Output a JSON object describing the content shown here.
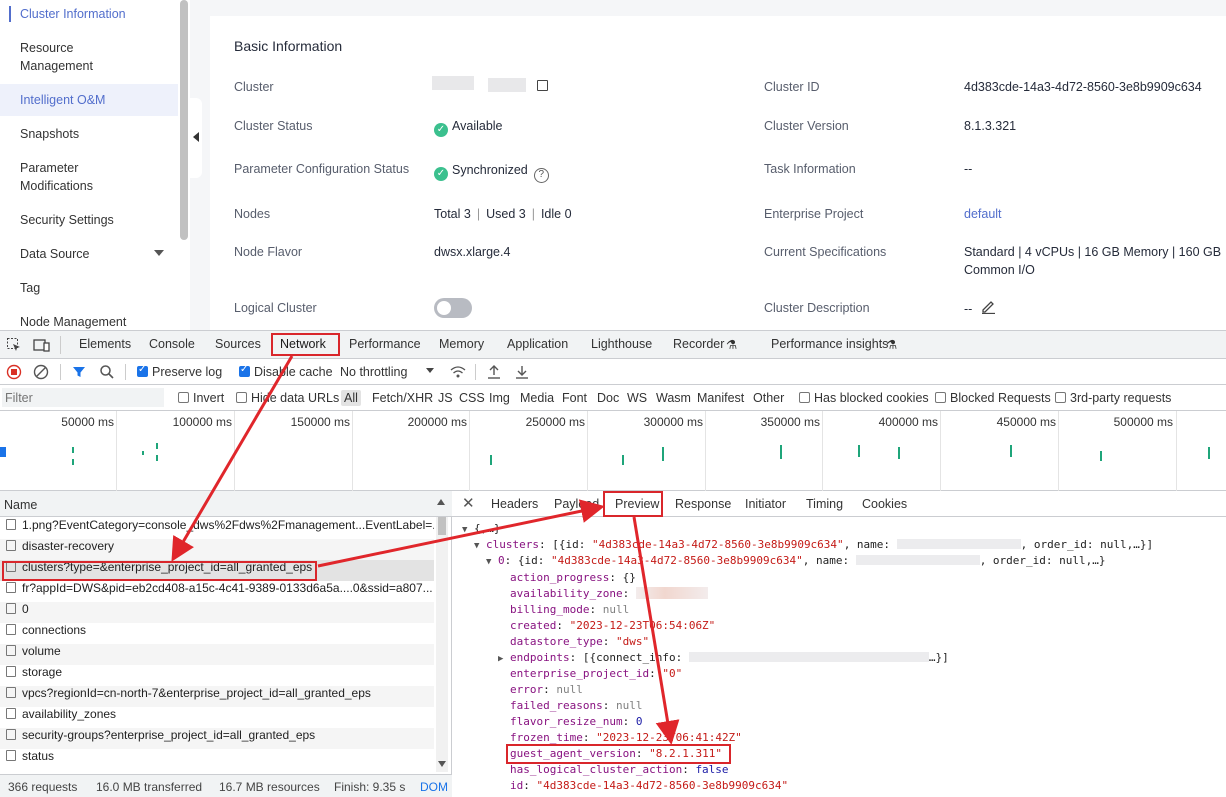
{
  "sidebar": {
    "items": [
      {
        "label": "Cluster Information"
      },
      {
        "label": "Resource Management"
      },
      {
        "label": "Intelligent O&M"
      },
      {
        "label": "Snapshots"
      },
      {
        "label": "Parameter Modifications"
      },
      {
        "label": "Security Settings"
      },
      {
        "label": "Data Source"
      },
      {
        "label": "Tag"
      },
      {
        "label": "Node Management"
      }
    ]
  },
  "basic": {
    "title": "Basic Information",
    "cluster_label": "Cluster",
    "cluster_status_label": "Cluster Status",
    "cluster_status": "Available",
    "param_status_label": "Parameter Configuration Status",
    "param_status": "Synchronized",
    "nodes_label": "Nodes",
    "nodes_total": "Total 3",
    "nodes_used": "Used 3",
    "nodes_idle": "Idle 0",
    "flavor_label": "Node Flavor",
    "flavor": "dwsx.xlarge.4",
    "logical_label": "Logical Cluster",
    "cluster_id_label": "Cluster ID",
    "cluster_id": "4d383cde-14a3-4d72-8560-3e8b9909c634",
    "version_label": "Cluster Version",
    "version": "8.1.3.321",
    "task_label": "Task Information",
    "task": "--",
    "ep_label": "Enterprise Project",
    "ep": "default",
    "spec_label": "Current Specifications",
    "spec_line1": "Standard | 4 vCPUs | 16 GB Memory | 160 GB",
    "spec_line2": "Common I/O",
    "desc_label": "Cluster Description",
    "desc": "--"
  },
  "devtools": {
    "tabs": [
      "Elements",
      "Console",
      "Sources",
      "Network",
      "Performance",
      "Memory",
      "Application",
      "Lighthouse",
      "Recorder",
      "Performance insights"
    ],
    "toolbar": {
      "preserve_log": "Preserve log",
      "disable_cache": "Disable cache",
      "throttling": "No throttling"
    },
    "filter": {
      "placeholder": "Filter",
      "invert": "Invert",
      "hide_data_urls": "Hide data URLs",
      "types": [
        "All",
        "Fetch/XHR",
        "JS",
        "CSS",
        "Img",
        "Media",
        "Font",
        "Doc",
        "WS",
        "Wasm",
        "Manifest",
        "Other"
      ],
      "has_blocked": "Has blocked cookies",
      "blocked_requests": "Blocked Requests",
      "third_party": "3rd-party requests"
    },
    "timeline_ticks": [
      "50000 ms",
      "100000 ms",
      "150000 ms",
      "200000 ms",
      "250000 ms",
      "300000 ms",
      "350000 ms",
      "400000 ms",
      "450000 ms",
      "500000 ms"
    ],
    "requests_header": "Name",
    "requests": [
      "1.png?EventCategory=console_dws%2Fdws%2Fmanagement...EventLabel=...",
      "disaster-recovery",
      "clusters?type=&enterprise_project_id=all_granted_eps",
      "fr?appId=DWS&pid=eb2cd408-a15c-4c41-9389-0133d6a5a....0&ssid=a807...",
      "0",
      "connections",
      "volume",
      "storage",
      "vpcs?regionId=cn-north-7&enterprise_project_id=all_granted_eps",
      "availability_zones",
      "security-groups?enterprise_project_id=all_granted_eps",
      "status"
    ],
    "status": {
      "requests": "366 requests",
      "transferred": "16.0 MB transferred",
      "resources": "16.7 MB resources",
      "finish": "Finish: 9.35 s",
      "dom": "DOM"
    },
    "detail_tabs": [
      "Headers",
      "Payload",
      "Preview",
      "Response",
      "Initiator",
      "Timing",
      "Cookies"
    ],
    "json": {
      "root": "{,…}",
      "clusters_key": "clusters",
      "clusters_summary_a": ": [{id: ",
      "clusters_id": "\"4d383cde-14a3-4d72-8560-3e8b9909c634\"",
      "clusters_summary_b": ", name: ",
      "clusters_summary_c": ", order_id: null,…}]",
      "item0_key": "0",
      "item0_a": ": {id: ",
      "item0_b": ", name: ",
      "item0_c": ", order_id: null,…}",
      "rows": [
        {
          "k": "action_progress",
          "v": "{}",
          "t": "plain"
        },
        {
          "k": "availability_zone",
          "v": "",
          "t": "blur"
        },
        {
          "k": "billing_mode",
          "v": "null",
          "t": "null"
        },
        {
          "k": "created",
          "v": "\"2023-12-23T06:54:06Z\"",
          "t": "str"
        },
        {
          "k": "datastore_type",
          "v": "\"dws\"",
          "t": "str"
        },
        {
          "k": "endpoints",
          "v": "[{connect_info: ",
          "t": "plain",
          "tail": "…}]"
        },
        {
          "k": "enterprise_project_id",
          "v": "\"0\"",
          "t": "str"
        },
        {
          "k": "error",
          "v": "null",
          "t": "null"
        },
        {
          "k": "failed_reasons",
          "v": "null",
          "t": "null"
        },
        {
          "k": "flavor_resize_num",
          "v": "0",
          "t": "num"
        },
        {
          "k": "frozen_time",
          "v": "\"2023-12-23T06:41:42Z\"",
          "t": "str"
        },
        {
          "k": "guest_agent_version",
          "v": "\"8.2.1.311\"",
          "t": "str"
        },
        {
          "k": "has_logical_cluster_action",
          "v": "false",
          "t": "num"
        },
        {
          "k": "id",
          "v": "\"4d383cde-14a3-4d72-8560-3e8b9909c634\"",
          "t": "str"
        }
      ]
    }
  },
  "colors": {
    "accent": "#526ecc",
    "annotation": "#d9262b",
    "success": "#3bc08e"
  }
}
